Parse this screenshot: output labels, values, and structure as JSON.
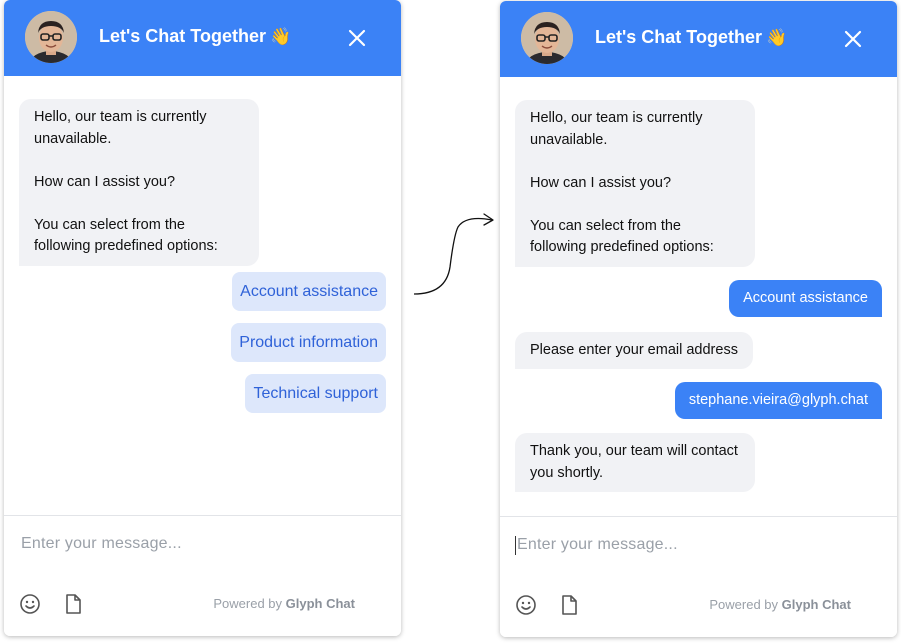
{
  "left_panel": {
    "header": {
      "title": "Let's Chat Together",
      "emoji": "👋",
      "avatar_icon": "avatar-photo",
      "close_icon": "close-icon"
    },
    "messages": {
      "bot_greeting": [
        "Hello, our team is currently unavailable.",
        "How can I assist you?",
        "You can select from the following predefined options:"
      ]
    },
    "options": [
      "Account assistance",
      "Product information",
      "Technical support"
    ],
    "composer": {
      "placeholder": "Enter your message...",
      "powered_prefix": "Powered by",
      "powered_brand": "Glyph Chat",
      "emoji_icon": "smiley-icon",
      "file_icon": "file-icon"
    }
  },
  "right_panel": {
    "header": {
      "title": "Let's Chat Together",
      "emoji": "👋",
      "avatar_icon": "avatar-photo",
      "close_icon": "close-icon"
    },
    "messages": {
      "bot_greeting": [
        "Hello, our team is currently unavailable.",
        "How can I assist you?",
        "You can select from the following predefined options:"
      ],
      "user_option": "Account assistance",
      "bot_email_prompt": "Please enter your email address",
      "user_email": "stephane.vieira@glyph.chat",
      "bot_thanks": "Thank you, our team will contact you shortly."
    },
    "composer": {
      "placeholder": "Enter your message...",
      "powered_prefix": "Powered by",
      "powered_brand": "Glyph Chat",
      "emoji_icon": "smiley-icon",
      "file_icon": "file-icon"
    }
  },
  "colors": {
    "accent": "#3b82f6",
    "option_bg": "#dde7fb",
    "option_text": "#2f62d8",
    "bot_bubble": "#f1f2f5"
  }
}
